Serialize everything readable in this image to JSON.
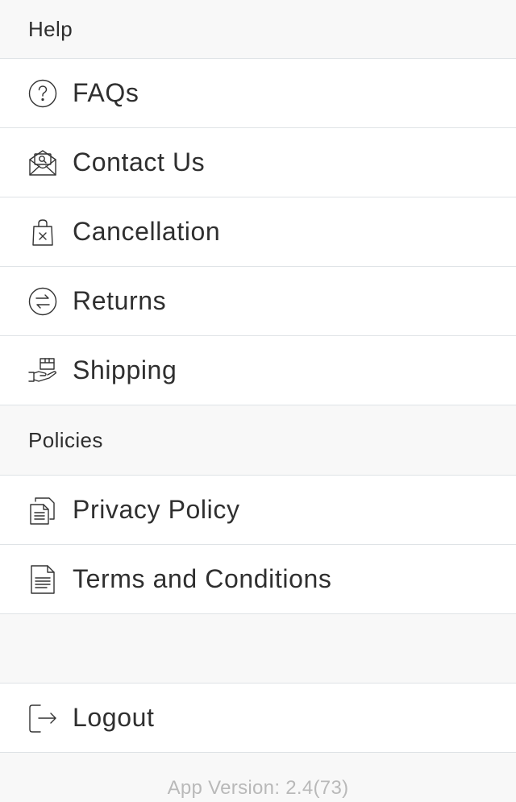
{
  "sections": {
    "help": {
      "title": "Help",
      "items": [
        {
          "label": "FAQs",
          "icon": "question-circle-icon"
        },
        {
          "label": "Contact Us",
          "icon": "envelope-search-icon"
        },
        {
          "label": "Cancellation",
          "icon": "bag-cancel-icon"
        },
        {
          "label": "Returns",
          "icon": "return-arrows-icon"
        },
        {
          "label": "Shipping",
          "icon": "hand-package-icon"
        }
      ]
    },
    "policies": {
      "title": "Policies",
      "items": [
        {
          "label": "Privacy Policy",
          "icon": "documents-icon"
        },
        {
          "label": "Terms and Conditions",
          "icon": "document-lines-icon"
        }
      ]
    }
  },
  "logout": {
    "label": "Logout",
    "icon": "logout-icon"
  },
  "footer": {
    "version": "App Version: 2.4(73)"
  },
  "colors": {
    "background": "#f8f8f8",
    "row_background": "#ffffff",
    "divider": "#dfe3e6",
    "text": "#2f2f2f",
    "muted_text": "#b9b9b9"
  }
}
